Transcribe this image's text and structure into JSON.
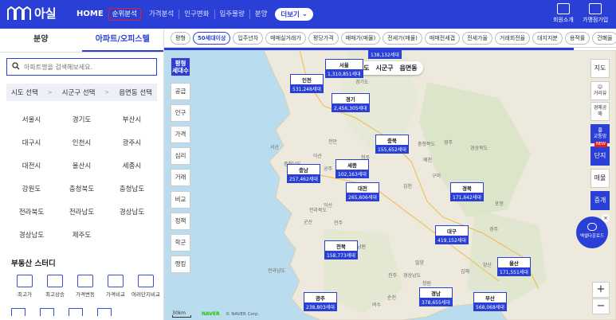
{
  "brand": {
    "name": "아실",
    "accent": "#2a3fd6",
    "alert": "#e0202a"
  },
  "nav": {
    "home": "HOME",
    "items": [
      "순위분석",
      "가격분석",
      "인구변화",
      "입주물량",
      "분양"
    ],
    "more": "더보기"
  },
  "top_right": [
    {
      "label": "회원소개",
      "icon": "building-icon"
    },
    {
      "label": "가맹점가입",
      "icon": "login-icon"
    }
  ],
  "left_tabs": [
    "분양",
    "아파트/오피스텔"
  ],
  "search": {
    "placeholder": "아파트명을 검색해보세요."
  },
  "region": [
    "시도 선택",
    "시군구 선택",
    "읍면동 선택"
  ],
  "regions": [
    "서울시",
    "경기도",
    "부산시",
    "대구시",
    "인천시",
    "광주시",
    "대전시",
    "울산시",
    "세종시",
    "강원도",
    "충청북도",
    "충청남도",
    "전라북도",
    "전라남도",
    "경상남도",
    "경상남도",
    "제주도"
  ],
  "study": {
    "title": "부동산 스터디",
    "tools": [
      "최고가",
      "최고상승",
      "가격변동",
      "가격비교",
      "여러단지비교"
    ]
  },
  "filters": [
    "평형",
    "50세대이상",
    "입주년차",
    "매매실거래가",
    "평당가격",
    "매매가(매물)",
    "전세가(매물)",
    "매매전세갭",
    "전세가율",
    "거래회전율",
    "대지지분",
    "용적률",
    "건폐율"
  ],
  "left_map_btns": [
    "공급",
    "인구",
    "가격",
    "심리",
    "거래",
    "비교",
    "정책",
    "학군",
    "랭킹"
  ],
  "left_map_top": {
    "line1": "평형",
    "line2": "세대수"
  },
  "right_map_btns": [
    "지도",
    "거리뷰",
    "경매공매",
    "교통망",
    "단지",
    "매물",
    "증개"
  ],
  "right_badge": "NEW",
  "level": [
    "시도",
    "시군구",
    "읍면동"
  ],
  "markers": [
    {
      "name": "서울",
      "value": "1,310,851세대"
    },
    {
      "name": "인천",
      "value": "531,248세대"
    },
    {
      "name": "경기",
      "value": "2,456,305세대"
    },
    {
      "name": "",
      "value": "138,132세대"
    },
    {
      "name": "충북",
      "value": "155,652세대"
    },
    {
      "name": "충남",
      "value": "257,462세대"
    },
    {
      "name": "세종",
      "value": "102,163세대"
    },
    {
      "name": "대전",
      "value": "265,606세대"
    },
    {
      "name": "경북",
      "value": "171,642세대"
    },
    {
      "name": "대구",
      "value": "419,152세대"
    },
    {
      "name": "전북",
      "value": "158,773세대"
    },
    {
      "name": "울산",
      "value": "171,551세대"
    },
    {
      "name": "광주",
      "value": "238,803세대"
    },
    {
      "name": "경남",
      "value": "378,655세대"
    },
    {
      "name": "부산",
      "value": "568,068세대"
    }
  ],
  "download": "엑셀다운로드",
  "map_labels": [
    "경기도",
    "충청북도",
    "경상북도",
    "충청남도",
    "전라북도",
    "경상남도",
    "전라남도",
    "서산",
    "예천",
    "영주",
    "군산",
    "전주",
    "포항",
    "경주",
    "양산",
    "김해",
    "순천",
    "여수",
    "창원",
    "밀양",
    "거제",
    "남원",
    "진주",
    "청주",
    "천안",
    "아산",
    "공주",
    "구미",
    "김천",
    "익산"
  ],
  "scale": "30km",
  "naver": "NAVER",
  "copyright": "© NAVER Corp."
}
